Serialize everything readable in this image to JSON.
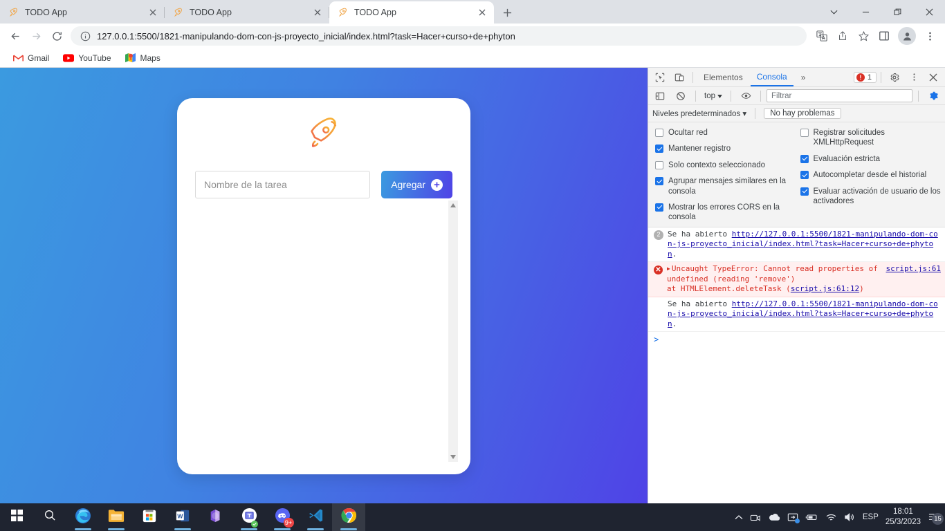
{
  "browser": {
    "tabs": [
      {
        "title": "TODO App",
        "favicon": "rocket-icon",
        "active": false
      },
      {
        "title": "TODO App",
        "favicon": "rocket-icon",
        "active": false
      },
      {
        "title": "TODO App",
        "favicon": "rocket-icon",
        "active": true
      }
    ],
    "new_tab_label": "+",
    "window_controls": {
      "tab_search": "tab-search-icon",
      "minimize": "minimize-icon",
      "maximize": "maximize-icon",
      "close": "close-icon"
    },
    "toolbar": {
      "back": "back-arrow-icon",
      "forward": "forward-arrow-icon",
      "reload": "reload-icon",
      "site_info": "info-circle-icon",
      "url": "127.0.0.1:5500/1821-manipulando-dom-con-js-proyecto_inicial/index.html?task=Hacer+curso+de+phyton",
      "translate": "translate-icon",
      "share": "share-icon",
      "bookmark": "star-icon",
      "side_panel": "side-panel-icon",
      "profile": "avatar-icon",
      "menu": "three-dot-menu-icon"
    },
    "bookmarks": [
      {
        "label": "Gmail",
        "icon": "gmail-icon"
      },
      {
        "label": "YouTube",
        "icon": "youtube-icon"
      },
      {
        "label": "Maps",
        "icon": "maps-icon"
      }
    ]
  },
  "page": {
    "background_from": "#3b9ae0",
    "background_to": "#4f43e6",
    "card": {
      "logo": "rocket-icon",
      "input_placeholder": "Nombre de la tarea",
      "input_value": "",
      "add_button_label": "Agregar",
      "add_button_icon": "plus-circle-icon",
      "task_items": []
    }
  },
  "devtools": {
    "tabs": [
      {
        "label": "Elementos",
        "active": false
      },
      {
        "label": "Consola",
        "active": true
      }
    ],
    "more_tabs": "»",
    "inspect_icon": "inspect-element-icon",
    "device_toolbar_icon": "device-toolbar-icon",
    "error_count": "1",
    "settings_icon": "gear-icon",
    "menu_icon": "three-dot-menu-icon",
    "close_icon": "close-icon",
    "filterbar": {
      "sidebar_icon": "console-sidebar-icon",
      "clear_icon": "clear-console-icon",
      "context": "top",
      "eye_icon": "live-expression-eye-icon",
      "filter_placeholder": "Filtrar",
      "filter_value": "",
      "settings_icon": "console-settings-gear-icon"
    },
    "levels": {
      "label": "Niveles predeterminados",
      "issues_button": "No hay problemas"
    },
    "settings_left": [
      {
        "label": "Ocultar red",
        "checked": false
      },
      {
        "label": "Mantener registro",
        "checked": true
      },
      {
        "label": "Solo contexto seleccionado",
        "checked": false
      },
      {
        "label": "Agrupar mensajes similares en la consola",
        "checked": true
      },
      {
        "label": "Mostrar los errores CORS en la consola",
        "checked": true
      }
    ],
    "settings_right": [
      {
        "label": "Registrar solicitudes XMLHttpRequest",
        "checked": false
      },
      {
        "label": "Evaluación estricta",
        "checked": true
      },
      {
        "label": "Autocompletar desde el historial",
        "checked": true
      },
      {
        "label": "Evaluar activación de usuario de los activadores",
        "checked": true
      }
    ],
    "messages": [
      {
        "type": "info",
        "count": "2",
        "text_prefix": "Se ha abierto ",
        "link": "http://127.0.0.1:5500/1821-manipulando-dom-con-js-proyecto_inicial/index.html?task=Hacer+curso+de+phyton",
        "text_suffix": "."
      },
      {
        "type": "error",
        "text": "Uncaught TypeError: Cannot read properties of undefined (reading 'remove')",
        "stack_prefix": "    at HTMLElement.deleteTask (",
        "stack_link": "script.js:61:12",
        "stack_suffix": ")",
        "source": "script.js:61"
      },
      {
        "type": "info",
        "count": "",
        "text_prefix": "Se ha abierto ",
        "link": "http://127.0.0.1:5500/1821-manipulando-dom-con-js-proyecto_inicial/index.html?task=Hacer+curso+de+phyton",
        "text_suffix": "."
      }
    ],
    "prompt_symbol": ">"
  },
  "taskbar": {
    "apps": [
      {
        "name": "start-button",
        "icon": "windows-logo-icon"
      },
      {
        "name": "search-button",
        "icon": "search-icon"
      },
      {
        "name": "edge",
        "icon": "edge-icon"
      },
      {
        "name": "file-explorer",
        "icon": "folder-icon"
      },
      {
        "name": "microsoft-store",
        "icon": "store-icon"
      },
      {
        "name": "word",
        "icon": "word-icon"
      },
      {
        "name": "microsoft-365",
        "icon": "m365-icon"
      },
      {
        "name": "teams",
        "icon": "teams-icon"
      },
      {
        "name": "discord",
        "icon": "discord-icon",
        "badge": "9+"
      },
      {
        "name": "vscode",
        "icon": "vscode-icon"
      },
      {
        "name": "chrome",
        "icon": "chrome-icon"
      }
    ],
    "tray": {
      "chevron": "show-hidden-icons-icon",
      "icons": [
        "camera-icon",
        "onedrive-icon",
        "screen-icon",
        "battery-icon",
        "wifi-icon",
        "volume-icon"
      ],
      "language": "ESP",
      "time": "18:01",
      "date": "25/3/2023",
      "notification_icon": "notification-icon",
      "notification_count": "15"
    }
  }
}
